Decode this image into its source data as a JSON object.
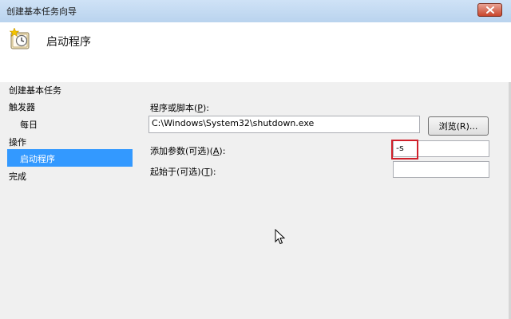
{
  "window": {
    "title": "创建基本任务向导"
  },
  "header": {
    "title": "启动程序"
  },
  "sidebar": {
    "items": [
      {
        "label": "创建基本任务"
      },
      {
        "label": "触发器"
      },
      {
        "label": "每日"
      },
      {
        "label": "操作"
      },
      {
        "label": "启动程序",
        "selected": true
      },
      {
        "label": "完成"
      }
    ]
  },
  "form": {
    "program": {
      "label_main": "程序或脚本(",
      "accel": "P",
      "label_end": "):",
      "value": "C:\\Windows\\System32\\shutdown.exe"
    },
    "browse_label": "浏览(R)...",
    "args": {
      "label_main": "添加参数(可选)(",
      "accel": "A",
      "label_end": "):",
      "value": "-s"
    },
    "startin": {
      "label_main": "起始于(可选)(",
      "accel": "T",
      "label_end": "):",
      "value": ""
    }
  },
  "colors": {
    "selection": "#3399ff",
    "highlight_box": "#d0202a"
  },
  "icons": {
    "header": "task-scheduler-clock-icon",
    "close": "close-icon",
    "cursor": "mouse-pointer-icon"
  }
}
